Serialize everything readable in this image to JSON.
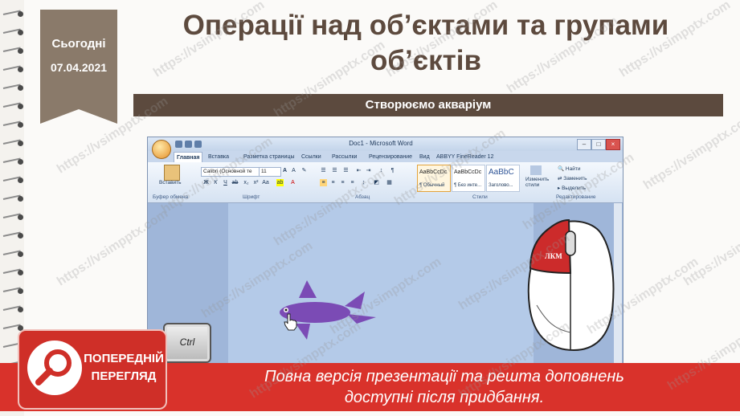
{
  "date_tag": {
    "today_label": "Сьогодні",
    "date": "07.04.2021"
  },
  "slide": {
    "title": "Операції над об’єктами та групами об’єктів",
    "subtitle": "Створюємо акваріум"
  },
  "word_window": {
    "title": "Doc1 - Microsoft Word",
    "tabs": [
      {
        "label": "Главная"
      },
      {
        "label": "Вставка"
      },
      {
        "label": "Разметка страницы"
      },
      {
        "label": "Ссылки"
      },
      {
        "label": "Рассылки"
      },
      {
        "label": "Рецензирование"
      },
      {
        "label": "Вид"
      },
      {
        "label": "ABBYY FineReader 12"
      }
    ],
    "ribbon": {
      "paste_label": "Вставить",
      "clipboard_group": "Буфер обмена",
      "font_name": "Calibri (Основной те",
      "font_size": "11",
      "font_group": "Шрифт",
      "paragraph_group": "Абзац",
      "styles": [
        {
          "sample": "AaBbCcDc",
          "name": "¶ Обычный"
        },
        {
          "sample": "AaBbCcDc",
          "name": "¶ Без инте..."
        },
        {
          "sample": "AaBbC",
          "name": "Заголово..."
        }
      ],
      "change_styles": "Изменить стили",
      "styles_group": "Стили",
      "find_label": "Найти",
      "replace_label": "Заменить",
      "select_label": "Выделить",
      "editing_group": "Редактирование"
    }
  },
  "ctrl_key": {
    "label": "Ctrl"
  },
  "mouse": {
    "button_label": "ЛКМ"
  },
  "colors": {
    "accent_brown": "#5c4a3e",
    "banner_red": "#d9322b",
    "fish_purple": "#7b4bb5"
  },
  "preview_banner": {
    "logo_line1": "ПОПЕРЕДНІЙ",
    "logo_line2": "ПЕРЕГЛЯД",
    "message_line1": "Повна версія презентації та решта доповнень",
    "message_line2": "доступні після придбання."
  },
  "watermark": "https://vsimpptx.com"
}
